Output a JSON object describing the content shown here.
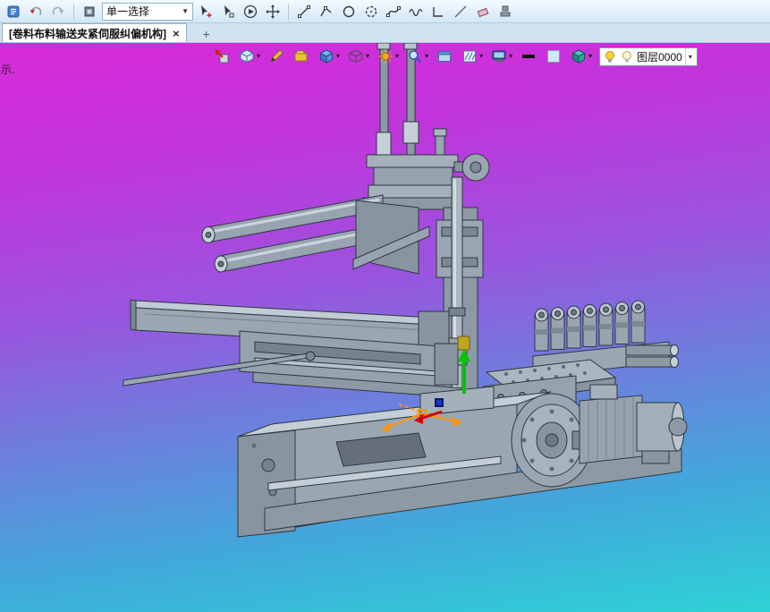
{
  "glyphs": {
    "caret_down": "▾",
    "dropdown_arrow": "▼"
  },
  "colors": {
    "viewport_gradient_top": "#d92ad8",
    "viewport_gradient_bottom": "#2ed2d6",
    "toolbar_bg": "#d2e7f5",
    "triad_orange": "#ff9500",
    "axis_green": "#00c400",
    "axis_red": "#d40000",
    "axis_blue": "#1a35cc"
  },
  "toolbar_top": {
    "selection_dropdown_value": "单一选择",
    "icons": [
      "journal",
      "undo",
      "redo",
      "selection-filter",
      "pick-add",
      "pick",
      "play",
      "pan",
      "line",
      "polyline",
      "circle",
      "arc",
      "spline",
      "wave",
      "corner",
      "segment",
      "eraser",
      "stamp"
    ]
  },
  "tabs": {
    "active_label": "[卷料布料输送夹紧伺服纠偏机构]",
    "close_glyph": "×",
    "new_tab_glyph": "+"
  },
  "viewport": {
    "hint": "示.",
    "layer_label": "图层0000",
    "overlay_icons": [
      "exit-sketch",
      "iso-view",
      "render-brush",
      "material",
      "solid-cube",
      "display-mode",
      "appearance",
      "zoom",
      "window",
      "hatch",
      "monitor",
      "line-width",
      "background",
      "view-cube",
      "layer-selector"
    ]
  }
}
